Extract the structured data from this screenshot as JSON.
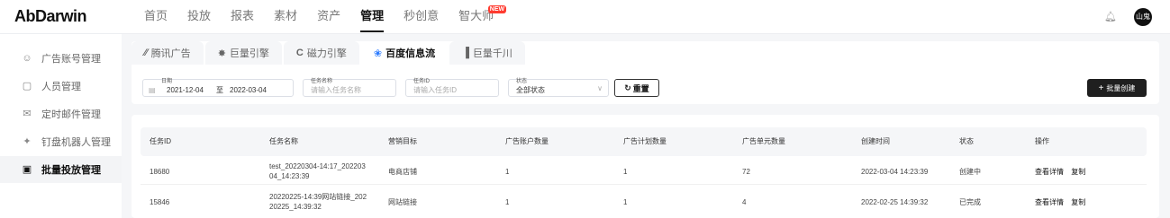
{
  "topnav": {
    "logo": "AbDarwin",
    "items": [
      "首页",
      "投放",
      "报表",
      "素材",
      "资产",
      "管理",
      "秒创意",
      "智大师"
    ],
    "active_index": 5,
    "new_badge": "NEW",
    "avatar": "山鬼"
  },
  "sidebar": {
    "items": [
      {
        "label": "广告账号管理",
        "icon": "smile-icon"
      },
      {
        "label": "人员管理",
        "icon": "person-icon"
      },
      {
        "label": "定时邮件管理",
        "icon": "mail-icon"
      },
      {
        "label": "钉盘机器人管理",
        "icon": "robot-icon"
      },
      {
        "label": "批量投放管理",
        "icon": "batch-icon"
      }
    ],
    "active_index": 4
  },
  "tabs": {
    "items": [
      "腾讯广告",
      "巨量引擎",
      "磁力引擎",
      "百度信息流",
      "巨量千川"
    ],
    "active_index": 3
  },
  "filters": {
    "date_label": "日期",
    "date_start": "2021-12-04",
    "date_sep": "至",
    "date_end": "2022-03-04",
    "task_name_label": "任务名称",
    "task_name_placeholder": "请输入任务名称",
    "task_id_label": "任务ID",
    "task_id_placeholder": "请输入任务ID",
    "status_label": "状态",
    "status_value": "全部状态",
    "reset_label": "重置",
    "create_label": "批量创建"
  },
  "table": {
    "columns": [
      "任务ID",
      "任务名称",
      "营销目标",
      "广告账户数量",
      "广告计划数量",
      "广告单元数量",
      "创建时间",
      "状态",
      "操作"
    ],
    "rows": [
      {
        "id": "18680",
        "name1": "test_20220304-14:17_202203",
        "name2": "04_14:23:39",
        "goal": "电商店铺",
        "accounts": "1",
        "plans": "1",
        "units": "72",
        "created": "2022-03-04 14:23:39",
        "status": "创建中",
        "op1": "查看详情",
        "op2": "复制"
      },
      {
        "id": "15846",
        "name1": "20220225-14:39网站链接_202",
        "name2": "20225_14:39:32",
        "goal": "网站链接",
        "accounts": "1",
        "plans": "1",
        "units": "4",
        "created": "2022-02-25 14:39:32",
        "status": "已完成",
        "op1": "查看详情",
        "op2": "复制"
      }
    ]
  }
}
